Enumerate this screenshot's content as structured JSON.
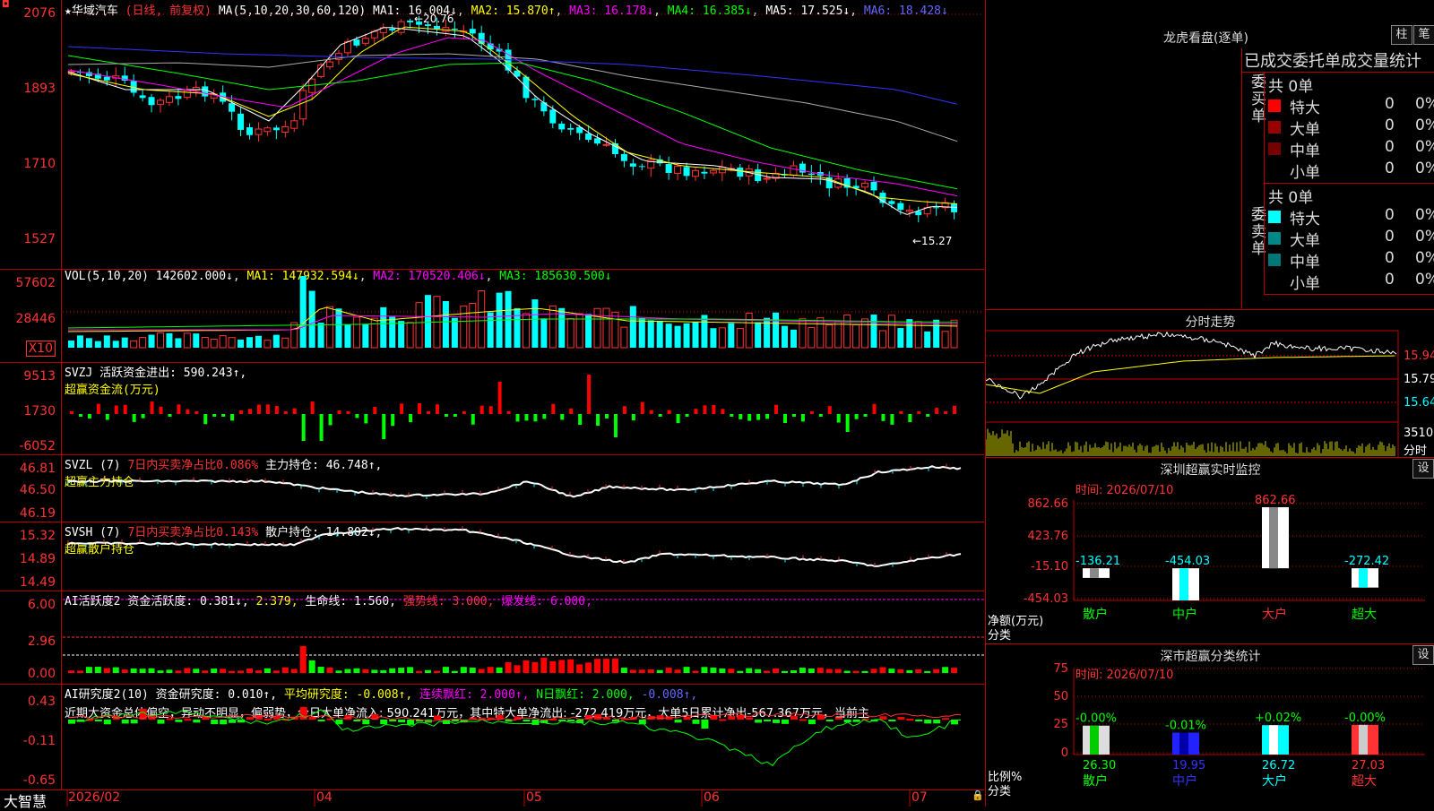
{
  "stock": {
    "name": "华域汽车",
    "period": "(日线, 前复权)"
  },
  "price_panel": {
    "ma_params": "MA(5,10,20,30,60,120)",
    "ma1": "MA1: 16.004↓",
    "ma2": "MA2: 15.870↑",
    "ma3": "MA3: 16.178↓",
    "ma4": "MA4: 16.385↓",
    "ma5": "MA5: 17.525↓",
    "ma6": "MA6: 18.428↓",
    "y_labels": [
      "2076",
      "1893",
      "1710",
      "1527"
    ],
    "high_label": "←20.76",
    "low_label": "←15.27"
  },
  "vol_panel": {
    "title": "VOL(5,10,20)",
    "value": "142602.000↓",
    "ma1": "MA1: 147932.594↓",
    "ma2": "MA2: 170520.406↓",
    "ma3": "MA3: 185630.500↓",
    "y_labels": [
      "57602",
      "28446"
    ],
    "unit": "X10"
  },
  "svzj_panel": {
    "title": "SVZJ",
    "desc": "活跃资金进出: 590.243↑,",
    "subtitle": "超赢资金流(万元)",
    "y_labels": [
      "9513",
      "1730",
      "-6052"
    ]
  },
  "svzl_panel": {
    "title": "SVZL (7)",
    "desc": "7日内买卖净占比0.086%",
    "value": "主力持仓: 46.748↑,",
    "subtitle": "超赢主力持仓",
    "y_labels": [
      "46.81",
      "46.50",
      "46.19"
    ]
  },
  "svsh_panel": {
    "title": "SVSH (7)",
    "desc": "7日内买卖净占比0.143%",
    "value": "散户持仓: 14.802↓,",
    "subtitle": "超赢散户持仓",
    "y_labels": [
      "15.32",
      "14.89",
      "14.49"
    ]
  },
  "ai_active": {
    "title": "AI活跃度2",
    "desc": "资金活跃度: 0.381↓,",
    "v2": "2.379,",
    "life": "生命线: 1.560,",
    "strong": "强势线: 3.000,",
    "burst": "爆发线: 6.000,",
    "y_labels": [
      "6.00",
      "2.96",
      "0.00"
    ]
  },
  "ai_research": {
    "title": "AI研究度2(10)",
    "desc": "资金研究度: 0.010↑,",
    "avg": "平均研究度: -0.008↑,",
    "cont": "连续飘红: 2.000↑,",
    "nday": "N日飘红: 2.000,",
    "last": "-0.008↑,",
    "y_labels": [
      "0.43",
      "-0.11",
      "-0.65"
    ],
    "commentary": "近期大资金总体偏空，异动不明显，偏弱势，今日大单净流入: 590.241万元，其中特大单净流出: -272.419万元，大单5日累计净出-567.367万元，当前主"
  },
  "x_axis": {
    "labels": [
      "2026/02",
      "04",
      "05",
      "06",
      "07"
    ],
    "brand": "大智慧"
  },
  "dragon": {
    "title": "龙虎看盘(逐单)",
    "btn1": "柱",
    "btn2": "笔",
    "header": "已成交委托单成交量统计",
    "buy": {
      "label": "委买单",
      "total": "共 0单",
      "rows": [
        {
          "name": "特大",
          "v": "0",
          "p": "0%"
        },
        {
          "name": "大单",
          "v": "0",
          "p": "0%"
        },
        {
          "name": "中单",
          "v": "0",
          "p": "0%"
        },
        {
          "name": "小单",
          "v": "0",
          "p": "0%"
        }
      ]
    },
    "sell": {
      "label": "委卖单",
      "total": "共 0单",
      "rows": [
        {
          "name": "特大",
          "v": "0",
          "p": "0%"
        },
        {
          "name": "大单",
          "v": "0",
          "p": "0%"
        },
        {
          "name": "中单",
          "v": "0",
          "p": "0%"
        },
        {
          "name": "小单",
          "v": "0",
          "p": "0%"
        }
      ]
    },
    "colors": {
      "buy": [
        "#ff0000",
        "#900000",
        "#700000",
        "#000000"
      ],
      "sell": [
        "#00ffff",
        "#008888",
        "#007777",
        "#000000"
      ]
    }
  },
  "intraday": {
    "title": "分时走势",
    "y_labels": [
      "15.94",
      "15.79",
      "15.64"
    ],
    "vol_label": "3510",
    "unit": "分时"
  },
  "monitor": {
    "title": "深圳超赢实时监控",
    "btn": "设",
    "time": "时间: 2026/07/10",
    "y_labels": [
      "862.66",
      "423.76",
      "-15.10",
      "-454.03"
    ],
    "ylabel": "净额(万元)",
    "xlabel": "分类",
    "chart_data": {
      "type": "bar",
      "categories": [
        "散户",
        "中户",
        "大户",
        "超大"
      ],
      "values": [
        -136.21,
        -454.03,
        862.66,
        -272.42
      ],
      "value_labels": [
        "-136.21",
        "-454.03",
        "862.66",
        "-272.42"
      ],
      "ylim": [
        -454.03,
        862.66
      ]
    }
  },
  "classify": {
    "title": "深市超赢分类统计",
    "btn": "设",
    "time": "时间: 2026/07/10",
    "y_labels": [
      "75",
      "50",
      "25",
      "0"
    ],
    "ylabel": "比例%",
    "xlabel": "分类",
    "chart_data": {
      "type": "bar",
      "categories": [
        "散户",
        "中户",
        "大户",
        "超大"
      ],
      "values": [
        26.3,
        19.95,
        26.72,
        27.03
      ],
      "value_labels": [
        "26.30",
        "19.95",
        "26.72",
        "27.03"
      ],
      "change_labels": [
        "-0.00%",
        "-0.01%",
        "+0.02%",
        "-0.00%"
      ],
      "ylim": [
        0,
        75
      ]
    }
  }
}
